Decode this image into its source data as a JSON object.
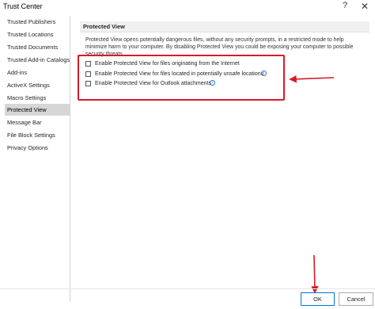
{
  "window": {
    "title": "Trust Center",
    "help_glyph": "?",
    "close_glyph": "✕"
  },
  "sidebar": {
    "items": [
      {
        "label": "Trusted Publishers"
      },
      {
        "label": "Trusted Locations"
      },
      {
        "label": "Trusted Documents"
      },
      {
        "label": "Trusted Add-in Catalogs"
      },
      {
        "label": "Add-ins"
      },
      {
        "label": "ActiveX Settings"
      },
      {
        "label": "Macro Settings"
      },
      {
        "label": "Protected View",
        "active": true
      },
      {
        "label": "Message Bar"
      },
      {
        "label": "File Block Settings"
      },
      {
        "label": "Privacy Options"
      }
    ]
  },
  "main": {
    "section_title": "Protected View",
    "description": "Protected View opens potentially dangerous files, without any security prompts, in a restricted mode to help minimize harm to your computer. By disabling Protected View you could be exposing your computer to possible security threats.",
    "options": [
      {
        "label": "Enable Protected View for files originating from the Internet",
        "checked": false,
        "has_info": false
      },
      {
        "label": "Enable Protected View for files located in potentially unsafe locations",
        "checked": false,
        "has_info": true
      },
      {
        "label": "Enable Protected View for Outlook attachments",
        "checked": false,
        "has_info": true
      }
    ],
    "info_glyph": "i"
  },
  "footer": {
    "ok_label": "OK",
    "cancel_label": "Cancel"
  },
  "colors": {
    "annotation": "#d8192a",
    "active_item": "#d6d6d6",
    "info": "#3b73c4"
  }
}
